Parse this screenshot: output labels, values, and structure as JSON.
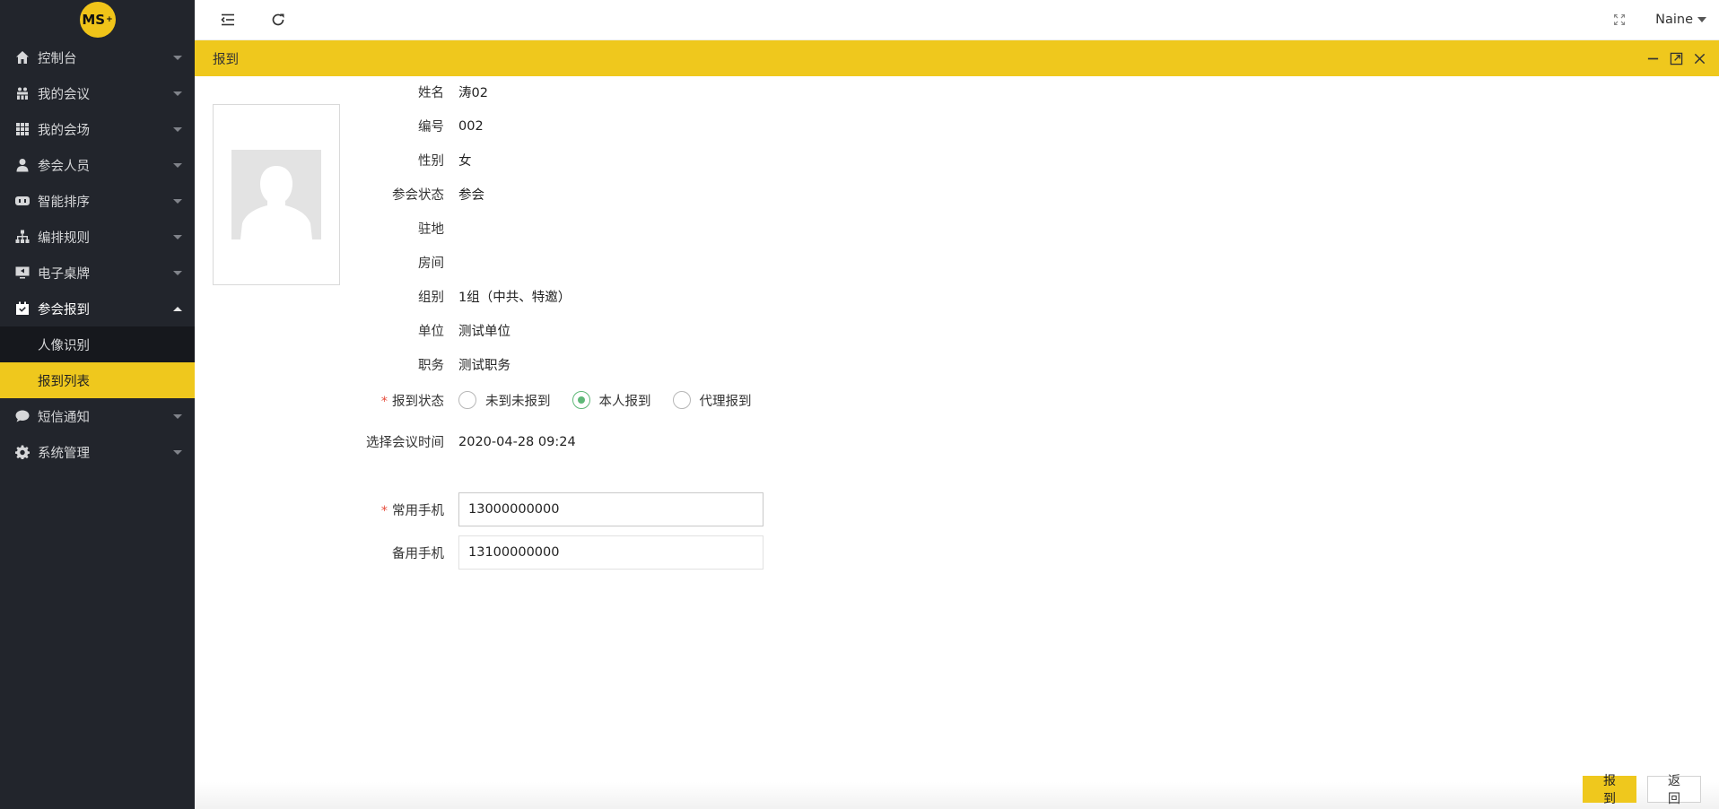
{
  "app": {
    "logo_text": "MS"
  },
  "sidebar": {
    "items": [
      {
        "label": "控制台",
        "icon": "home-icon"
      },
      {
        "label": "我的会议",
        "icon": "meeting-icon"
      },
      {
        "label": "我的会场",
        "icon": "grid-icon"
      },
      {
        "label": "参会人员",
        "icon": "user-icon"
      },
      {
        "label": "智能排序",
        "icon": "robot-icon"
      },
      {
        "label": "编排规则",
        "icon": "hierarchy-icon"
      },
      {
        "label": "电子桌牌",
        "icon": "monitor-icon"
      },
      {
        "label": "参会报到",
        "icon": "calendar-check-icon",
        "open": true
      },
      {
        "label": "短信通知",
        "icon": "sms-icon"
      },
      {
        "label": "系统管理",
        "icon": "gear-icon"
      }
    ],
    "submenu": [
      {
        "label": "人像识别"
      },
      {
        "label": "报到列表",
        "active": true
      }
    ]
  },
  "topbar": {
    "user_name": "Naine"
  },
  "panel": {
    "title": "报到"
  },
  "form": {
    "name_label": "姓名",
    "name_value": "涛02",
    "code_label": "编号",
    "code_value": "002",
    "gender_label": "性别",
    "gender_value": "女",
    "status_label": "参会状态",
    "status_value": "参会",
    "station_label": "驻地",
    "station_value": "",
    "room_label": "房间",
    "room_value": "",
    "group_label": "组别",
    "group_value": "1组（中共、特邀）",
    "unit_label": "单位",
    "unit_value": "测试单位",
    "duty_label": "职务",
    "duty_value": "测试职务",
    "checkin_label": "报到状态",
    "checkin_options": [
      "未到未报到",
      "本人报到",
      "代理报到"
    ],
    "checkin_selected": "本人报到",
    "time_label": "选择会议时间",
    "time_value": "2020-04-28 09:24",
    "phone_label": "常用手机",
    "phone_value": "13000000000",
    "phone2_label": "备用手机",
    "phone2_value": "13100000000"
  },
  "actions": {
    "submit_label": "报到",
    "back_label": "返回"
  },
  "colors": {
    "accent": "#efc81d",
    "sidebar_bg": "#22252c",
    "radio_checked": "#5fb878",
    "required": "#e64c3c"
  }
}
